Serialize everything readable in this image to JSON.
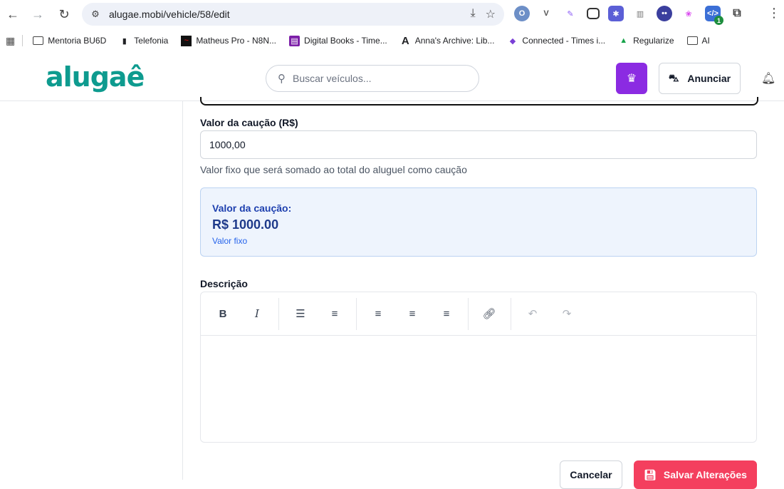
{
  "browser": {
    "url": "alugae.mobi/vehicle/58/edit",
    "bookmarks": [
      {
        "label": "Mentoria BU6D",
        "icon": "folder-icon"
      },
      {
        "label": "Telefonia",
        "icon": "phone-icon"
      },
      {
        "label": "Matheus Pro - N8N...",
        "icon": "n8n-icon"
      },
      {
        "label": "Digital Books - Time...",
        "icon": "book-icon"
      },
      {
        "label": "Anna's Archive: Lib...",
        "icon": "annas-archive-icon"
      },
      {
        "label": "Connected - Times i...",
        "icon": "connected-icon"
      },
      {
        "label": "Regularize",
        "icon": "regularize-icon"
      },
      {
        "label": "AI",
        "icon": "folder-icon"
      }
    ],
    "extension_badge": "1"
  },
  "header": {
    "logo": "alugaê",
    "search_placeholder": "Buscar veículos...",
    "anunciar_label": "Anunciar",
    "accent_color": "#8b2be2"
  },
  "form": {
    "deposit_label": "Valor da caução (R$)",
    "deposit_value": "1000,00",
    "deposit_hint": "Valor fixo que será somado ao total do aluguel como caução",
    "summary": {
      "title": "Valor da caução:",
      "amount": "R$ 1000.00",
      "note": "Valor fixo"
    },
    "description_label": "Descrição",
    "cancel_label": "Cancelar",
    "save_label": "Salvar Alterações",
    "save_color": "#f43f5e"
  }
}
